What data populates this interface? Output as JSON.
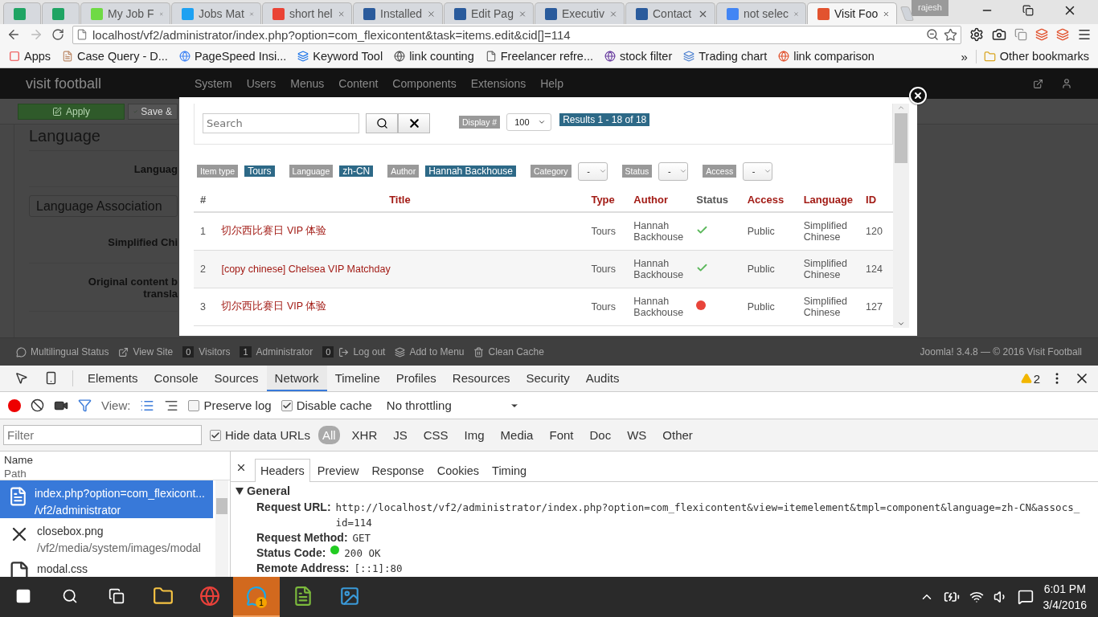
{
  "browser": {
    "tabs": [
      {
        "selected": false
      },
      {
        "selected": false
      },
      {
        "label": "My Job F",
        "selected": false
      },
      {
        "label": "Jobs Mat",
        "selected": false
      },
      {
        "label": "short hel",
        "selected": false
      },
      {
        "label": "Installed",
        "selected": false
      },
      {
        "label": "Edit Pag",
        "selected": false
      },
      {
        "label": "Executiv",
        "selected": false
      },
      {
        "label": "Contact",
        "selected": false
      },
      {
        "label": "not selec",
        "selected": false
      },
      {
        "label": "Visit Foo",
        "selected": true
      }
    ],
    "profile": "rajesh",
    "url": "localhost/vf2/administrator/index.php?option=com_flexicontent&task=items.edit&cid[]=114",
    "bookmarks": [
      "Apps",
      "Case Query - D...",
      "PageSpeed Insi...",
      "Keyword Tool",
      "link counting",
      "Freelancer refre...",
      "stock filter",
      "Trading chart",
      "link comparison"
    ],
    "bookmarks_more": "»",
    "other_bookmarks": "Other bookmarks"
  },
  "admin": {
    "brand": "visit football",
    "menu": [
      "System",
      "Users",
      "Menus",
      "Content",
      "Components",
      "Extensions",
      "Help"
    ],
    "toolbar": [
      "Apply",
      "Save &"
    ],
    "page_title": "Language",
    "field_label": "Languag",
    "association_title": "Language Association",
    "association_label": "Simplified Chi",
    "original_label_lines": [
      "Original content b",
      "transla"
    ],
    "status_items": [
      {
        "kind": "link",
        "text": "Multilingual Status"
      },
      {
        "kind": "link",
        "text": "View Site"
      },
      {
        "kind": "count",
        "text": "0"
      },
      {
        "kind": "link",
        "text": "Visitors"
      },
      {
        "kind": "count",
        "text": "1"
      },
      {
        "kind": "link",
        "text": "Administrator"
      },
      {
        "kind": "count",
        "text": "0"
      },
      {
        "kind": "link",
        "text": "Log out"
      },
      {
        "kind": "link",
        "text": "Add to Menu"
      },
      {
        "kind": "link",
        "text": "Clean Cache"
      }
    ],
    "footer": "Joomla! 3.4.8 — © 2016 Visit Football"
  },
  "modal": {
    "search_placeholder": "Search",
    "display_label": "Display #",
    "display_value": "100",
    "results": "Results 1 - 18 of 18",
    "filters": [
      {
        "kind": "tag",
        "label": "Item type",
        "value": "Tours"
      },
      {
        "kind": "tag",
        "label": "Language",
        "value": "zh-CN"
      },
      {
        "kind": "tag",
        "label": "Author",
        "value": "Hannah Backhouse"
      },
      {
        "kind": "select",
        "label": "Category",
        "value": "-"
      },
      {
        "kind": "select",
        "label": "Status",
        "value": "-"
      },
      {
        "kind": "select",
        "label": "Access",
        "value": "-"
      }
    ],
    "columns": [
      "#",
      "Title",
      "Type",
      "Author",
      "Status",
      "Access",
      "Language",
      "ID"
    ],
    "rows": [
      {
        "num": "1",
        "title": "切尔西比赛日 VIP 体验",
        "type": "Tours",
        "author": "Hannah Backhouse",
        "published": true,
        "access": "Public",
        "language": "Simplified Chinese",
        "id": "120"
      },
      {
        "num": "2",
        "title": "[copy chinese] Chelsea VIP Matchday",
        "type": "Tours",
        "author": "Hannah Backhouse",
        "published": true,
        "access": "Public",
        "language": "Simplified Chinese",
        "id": "124"
      },
      {
        "num": "3",
        "title": "切尔西比赛日 VIP 体验",
        "type": "Tours",
        "author": "Hannah Backhouse",
        "published": false,
        "access": "Public",
        "language": "Simplified Chinese",
        "id": "127"
      }
    ]
  },
  "devtools": {
    "tabs": [
      {
        "label": "Elements",
        "selected": false
      },
      {
        "label": "Console",
        "selected": false
      },
      {
        "label": "Sources",
        "selected": false
      },
      {
        "label": "Network",
        "selected": true
      },
      {
        "label": "Timeline",
        "selected": false
      },
      {
        "label": "Profiles",
        "selected": false
      },
      {
        "label": "Resources",
        "selected": false
      },
      {
        "label": "Security",
        "selected": false
      },
      {
        "label": "Audits",
        "selected": false
      }
    ],
    "warnings": "2",
    "recording": true,
    "filter_on": true,
    "view_label": "View:",
    "preserve_log": {
      "label": "Preserve log",
      "checked": false
    },
    "disable_cache": {
      "label": "Disable cache",
      "checked": true
    },
    "throttling": "No throttling",
    "filter_placeholder": "Filter",
    "hide_data_urls": {
      "label": "Hide data URLs",
      "checked": true
    },
    "types": [
      {
        "label": "All",
        "selected": true
      },
      {
        "label": "XHR",
        "selected": false
      },
      {
        "label": "JS",
        "selected": false
      },
      {
        "label": "CSS",
        "selected": false
      },
      {
        "label": "Img",
        "selected": false
      },
      {
        "label": "Media",
        "selected": false
      },
      {
        "label": "Font",
        "selected": false
      },
      {
        "label": "Doc",
        "selected": false
      },
      {
        "label": "WS",
        "selected": false
      },
      {
        "label": "Other",
        "selected": false
      }
    ],
    "list_header": {
      "name": "Name",
      "path": "Path"
    },
    "requests": [
      {
        "kind": "document",
        "name": "index.php?option=com_flexicont...",
        "path": "/vf2/administrator",
        "selected": true
      },
      {
        "kind": "image",
        "name": "closebox.png",
        "path": "/vf2/media/system/images/modal",
        "selected": false
      },
      {
        "kind": "style",
        "name": "modal.css",
        "selected": false
      }
    ],
    "detail_tabs": [
      {
        "label": "Headers",
        "selected": true
      },
      {
        "label": "Preview",
        "selected": false
      },
      {
        "label": "Response",
        "selected": false
      },
      {
        "label": "Cookies",
        "selected": false
      },
      {
        "label": "Timing",
        "selected": false
      }
    ],
    "section": "General",
    "headers": [
      {
        "kind": "text",
        "key": "Request URL:",
        "value": "http://localhost/vf2/administrator/index.php?option=com_flexicontent&view=itemelement&tmpl=component&language=zh-CN&assocs_id=114"
      },
      {
        "kind": "text",
        "key": "Request Method:",
        "value": "GET"
      },
      {
        "kind": "status",
        "key": "Status Code:",
        "value": "200 OK"
      },
      {
        "kind": "text",
        "key": "Remote Address:",
        "value": "[::1]:80"
      }
    ]
  },
  "taskbar": {
    "apps": [
      {
        "selected": false
      },
      {
        "selected": false
      },
      {
        "selected": true,
        "badge": "1"
      },
      {
        "selected": false
      },
      {
        "selected": false
      }
    ],
    "time": "6:01 PM",
    "date": "3/4/2016"
  }
}
